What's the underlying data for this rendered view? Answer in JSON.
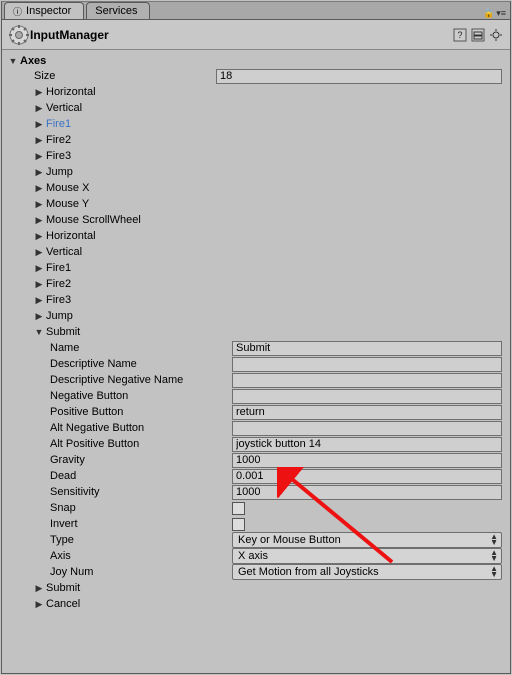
{
  "tabs": {
    "inspector": "Inspector",
    "services": "Services"
  },
  "header": {
    "title": "InputManager",
    "tool_help": "?",
    "tool_preset": "▭",
    "tool_gear": "✲"
  },
  "axes": {
    "label": "Axes",
    "size_label": "Size",
    "size_value": "18",
    "items": [
      "Horizontal",
      "Vertical",
      "Fire1",
      "Fire2",
      "Fire3",
      "Jump",
      "Mouse X",
      "Mouse Y",
      "Mouse ScrollWheel",
      "Horizontal",
      "Vertical",
      "Fire1",
      "Fire2",
      "Fire3",
      "Jump",
      "Submit",
      "Submit",
      "Cancel"
    ],
    "expanded_index": 15,
    "selected_index": 2
  },
  "submit": {
    "fields": {
      "name_label": "Name",
      "name_value": "Submit",
      "descriptive_name_label": "Descriptive Name",
      "descriptive_name_value": "",
      "descriptive_negative_label": "Descriptive Negative Name",
      "descriptive_negative_value": "",
      "negative_button_label": "Negative Button",
      "negative_button_value": "",
      "positive_button_label": "Positive Button",
      "positive_button_value": "return",
      "alt_negative_button_label": "Alt Negative Button",
      "alt_negative_button_value": "",
      "alt_positive_button_label": "Alt Positive Button",
      "alt_positive_button_value": "joystick button 14",
      "gravity_label": "Gravity",
      "gravity_value": "1000",
      "dead_label": "Dead",
      "dead_value": "0.001",
      "sensitivity_label": "Sensitivity",
      "sensitivity_value": "1000",
      "snap_label": "Snap",
      "snap_value": false,
      "invert_label": "Invert",
      "invert_value": false,
      "type_label": "Type",
      "type_value": "Key or Mouse Button",
      "axis_label": "Axis",
      "axis_value": "X axis",
      "joynum_label": "Joy Num",
      "joynum_value": "Get Motion from all Joysticks"
    }
  }
}
